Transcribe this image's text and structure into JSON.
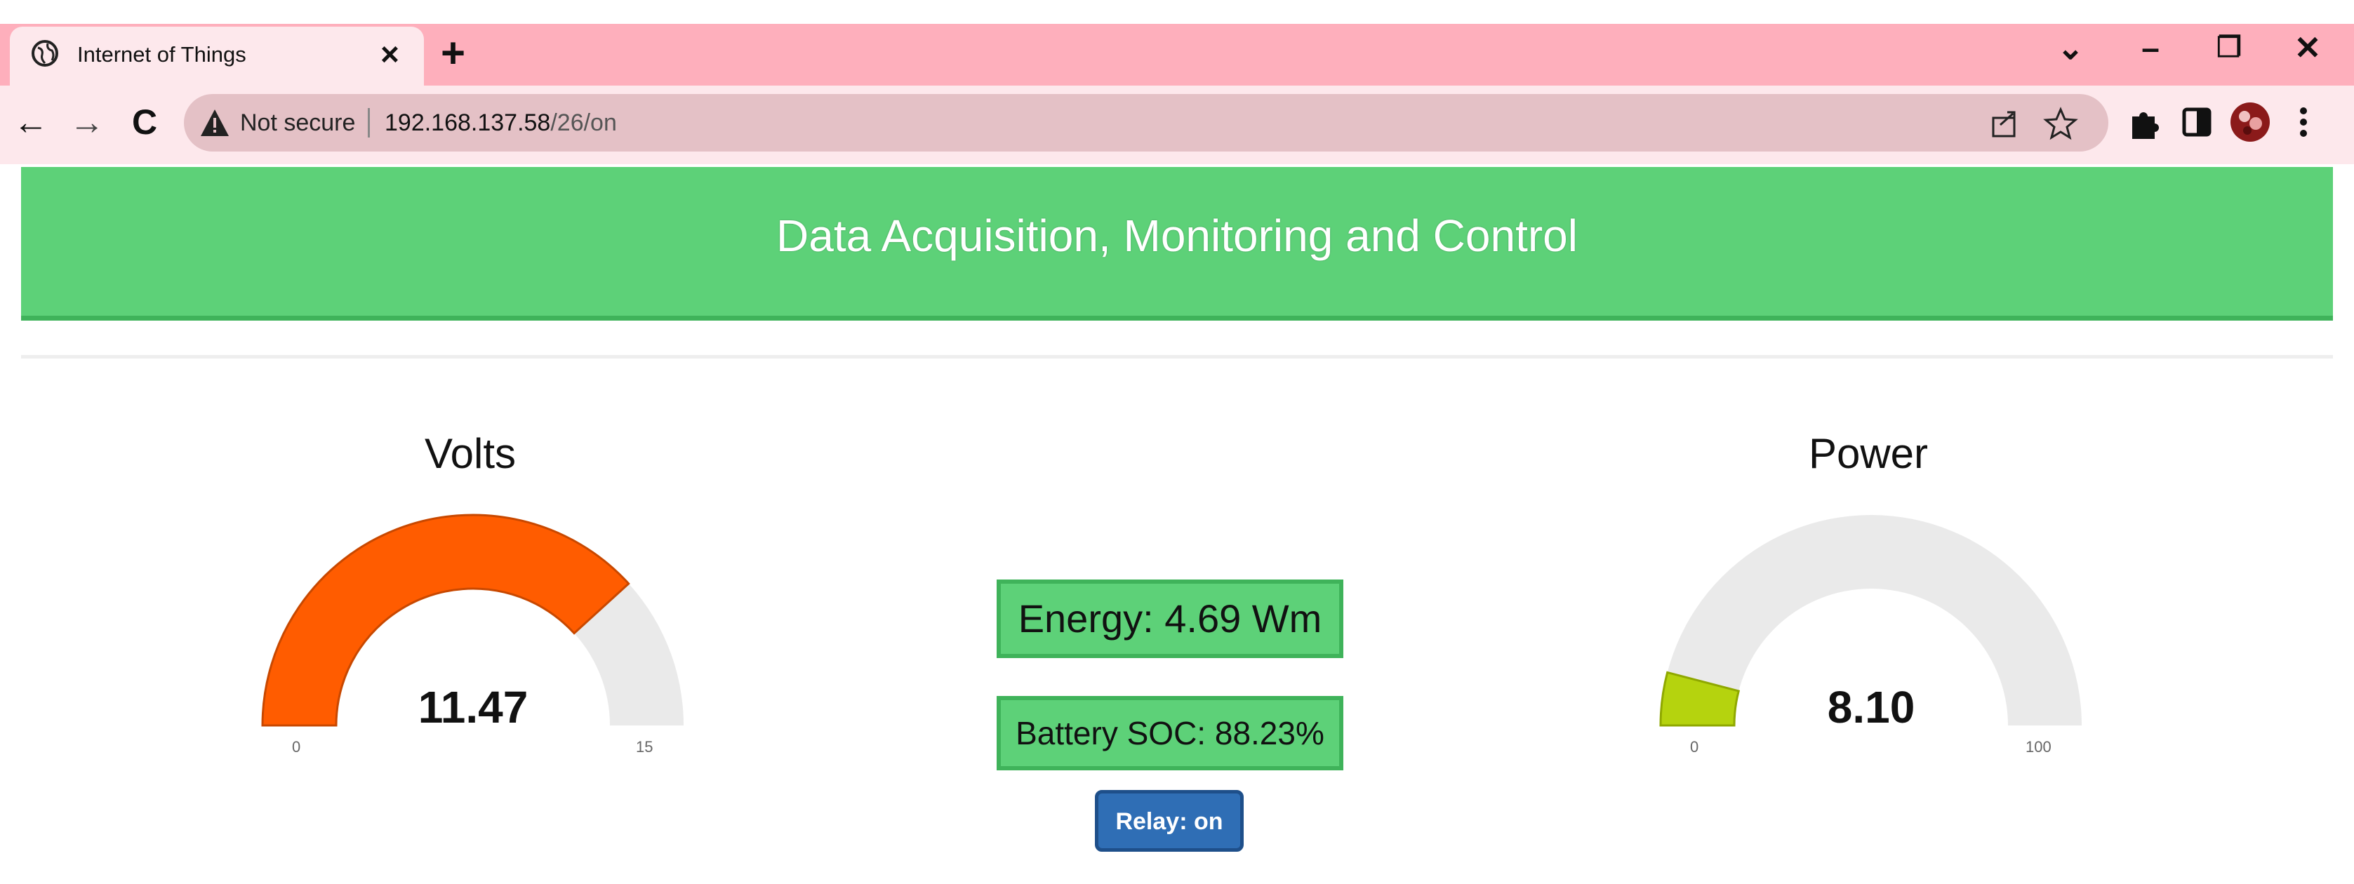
{
  "browser": {
    "tab_title": "Internet of Things",
    "tab_close": "×",
    "new_tab": "+",
    "window_controls": {
      "tab_search": "⌄",
      "minimize": "–",
      "restore": "❐",
      "close": "✕"
    },
    "nav": {
      "back": "←",
      "forward": "→",
      "reload": "C"
    },
    "security_label": "Not secure",
    "url_host": "192.168.137.58",
    "url_path": "/26/on",
    "icons": [
      "globe-icon",
      "warning-icon",
      "share-icon",
      "star-icon",
      "extensions-icon",
      "sidepanel-icon",
      "profile-avatar",
      "menu-icon"
    ],
    "colors": {
      "tabbar": "#feafbc",
      "toolbar": "#fde8ec",
      "omnibox": "#e4c1c6"
    }
  },
  "page": {
    "header_title": "Data Acquisition, Monitoring and Control",
    "colors": {
      "header": "#5dd178",
      "header_border": "#3fb35a",
      "button": "#2f6eb5"
    }
  },
  "gauges": [
    {
      "title": "Volts",
      "value": 11.47,
      "value_label": "11.47",
      "min": 0,
      "max": 15,
      "min_label": "0",
      "max_label": "15",
      "color": "#ff5c00"
    },
    {
      "title": "Power",
      "value": 8.1,
      "value_label": "8.10",
      "min": 0,
      "max": 100,
      "min_label": "0",
      "max_label": "100",
      "color": "#b5d30e"
    }
  ],
  "energy_text": "Energy: 4.69 Wm",
  "soc_text": "Battery SOC: 88.23%",
  "relay_label": "Relay: on"
}
